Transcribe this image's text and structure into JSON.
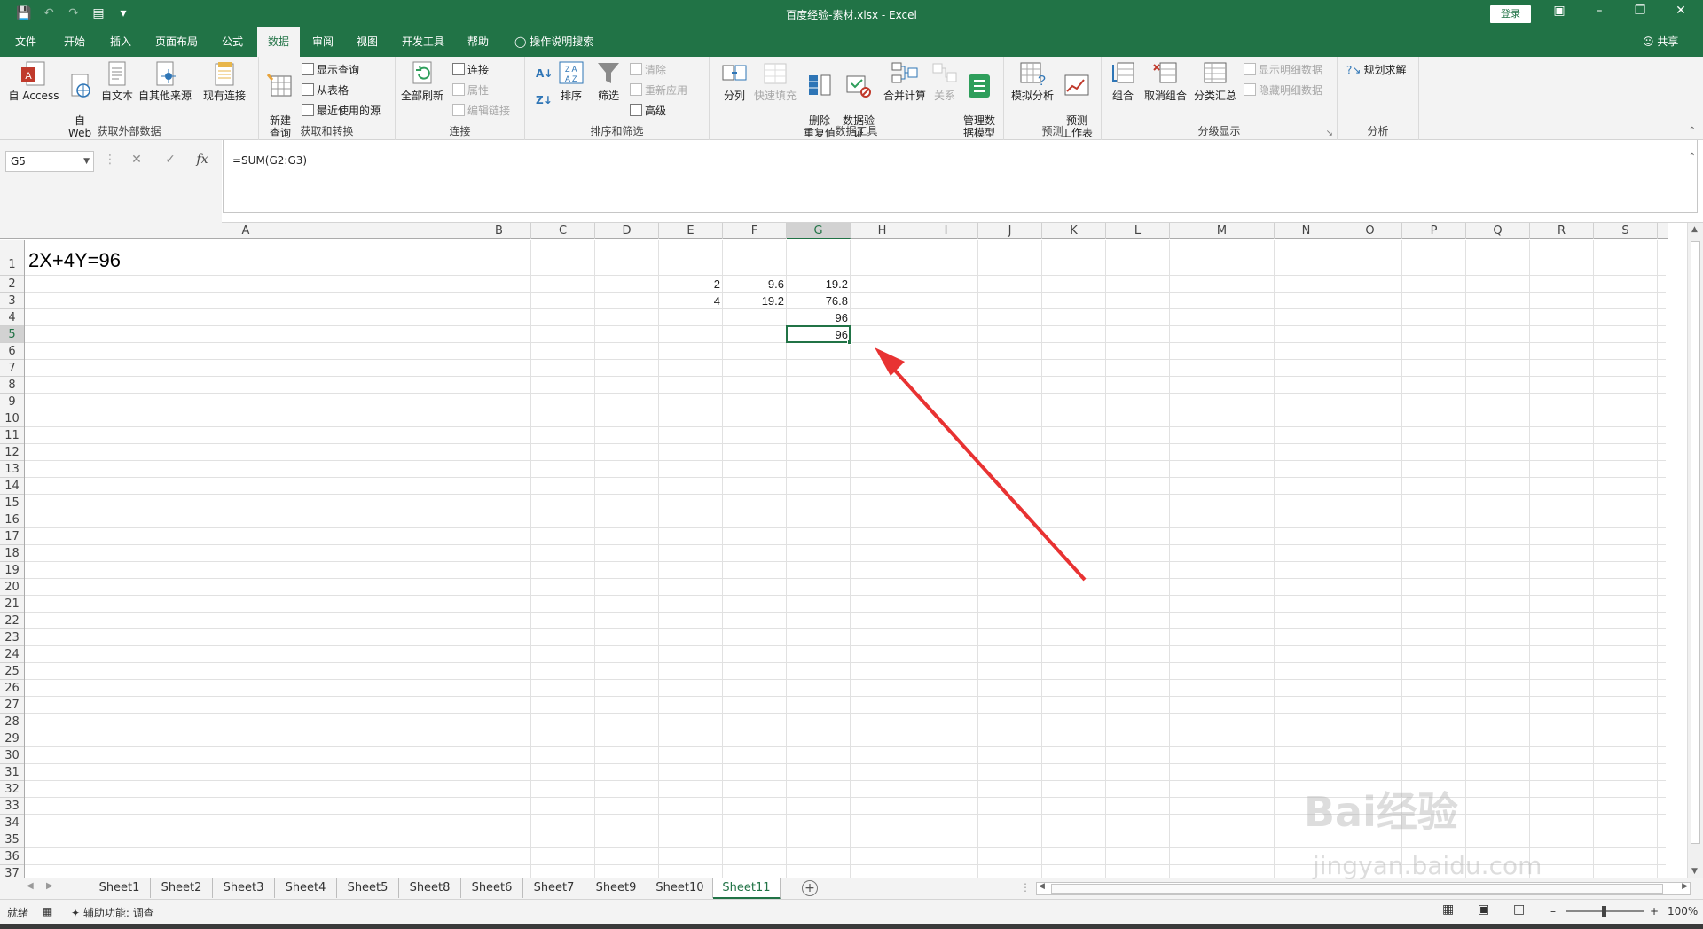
{
  "colors": {
    "accent": "#217346",
    "arrow": "#e83232"
  },
  "titlebar": {
    "title": "百度经验-素材.xlsx - Excel",
    "login_label": "登录",
    "icons": [
      "save-icon",
      "undo-icon",
      "redo-icon",
      "form-icon",
      "customize-qat-icon"
    ]
  },
  "tabs": [
    {
      "label": "文件"
    },
    {
      "label": "开始"
    },
    {
      "label": "插入"
    },
    {
      "label": "页面布局"
    },
    {
      "label": "公式"
    },
    {
      "label": "数据"
    },
    {
      "label": "审阅"
    },
    {
      "label": "视图"
    },
    {
      "label": "开发工具"
    },
    {
      "label": "帮助"
    }
  ],
  "tell_me": "操作说明搜索",
  "share": "共享",
  "ribbon": {
    "groups": {
      "external": {
        "label": "获取外部数据",
        "access": "自 Access",
        "web": "自\nWeb",
        "text": "自文本",
        "other": "自其他来源",
        "existing": "现有连接"
      },
      "transform": {
        "label": "获取和转换",
        "new_query": "新建\n查询",
        "show_query": "显示查询",
        "from_table": "从表格",
        "recent": "最近使用的源"
      },
      "connections": {
        "label": "连接",
        "refresh": "全部刷新",
        "connections": "连接",
        "properties": "属性",
        "edit_links": "编辑链接"
      },
      "sort": {
        "label": "排序和筛选",
        "sort": "排序",
        "filter": "筛选",
        "clear": "清除",
        "reapply": "重新应用",
        "advanced": "高级"
      },
      "tools": {
        "label": "数据工具",
        "split": "分列",
        "flash": "快速填充",
        "dedupe": "删除\n重复值",
        "validate": "数据验\n证",
        "consolidate": "合并计算",
        "relations": "关系",
        "model": "管理数\n据模型"
      },
      "forecast": {
        "label": "预测",
        "whatif": "模拟分析",
        "sheet": "预测\n工作表"
      },
      "outline": {
        "label": "分级显示",
        "group": "组合",
        "ungroup": "取消组合",
        "subtotal": "分类汇总",
        "show_detail": "显示明细数据",
        "hide_detail": "隐藏明细数据"
      },
      "analysis": {
        "label": "分析",
        "solver": "规划求解"
      }
    }
  },
  "formula_bar": {
    "name_box": "G5",
    "formula": "=SUM(G2:G3)"
  },
  "columns": [
    "A",
    "B",
    "C",
    "D",
    "E",
    "F",
    "G",
    "H",
    "I",
    "J",
    "K",
    "L",
    "M",
    "N",
    "O",
    "P",
    "Q",
    "R",
    "S"
  ],
  "rows": [
    "1",
    "2",
    "3",
    "4",
    "5",
    "6",
    "7",
    "8",
    "9",
    "10",
    "11",
    "12",
    "13",
    "14",
    "15",
    "16",
    "17",
    "18",
    "19",
    "20",
    "21",
    "22",
    "23",
    "24",
    "25",
    "26",
    "27",
    "28",
    "29",
    "30",
    "31",
    "32",
    "33",
    "34",
    "35",
    "36",
    "37"
  ],
  "cells": {
    "A1": "2X+4Y=96",
    "E2": "2",
    "F2": "9.6",
    "G2": "19.2",
    "E3": "4",
    "F3": "19.2",
    "G3": "76.8",
    "G4": "96",
    "G5": "96"
  },
  "selected_cell": "G5",
  "sheets": [
    "Sheet1",
    "Sheet2",
    "Sheet3",
    "Sheet4",
    "Sheet5",
    "Sheet8",
    "Sheet6",
    "Sheet7",
    "Sheet9",
    "Sheet10",
    "Sheet11"
  ],
  "active_sheet": "Sheet11",
  "status": {
    "ready": "就绪",
    "accessibility": "辅助功能: 调查",
    "zoom": "100%"
  },
  "watermark": {
    "brand": "Bai经验",
    "url": "jingyan.baidu.com"
  }
}
